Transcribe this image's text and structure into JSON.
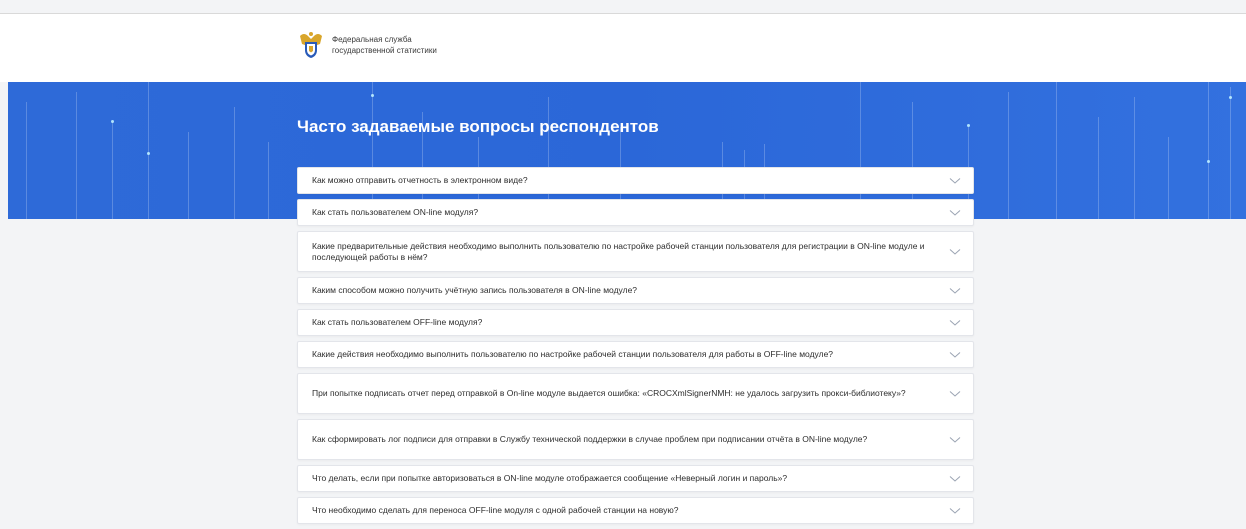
{
  "header": {
    "org_line1": "Федеральная служба",
    "org_line2": "государственной статистики"
  },
  "hero": {
    "title": "Часто задаваемые вопросы респондентов"
  },
  "faq": [
    {
      "question": "Как можно отправить отчетность в электронном виде?"
    },
    {
      "question": "Как стать пользователем ON-line модуля?"
    },
    {
      "question": "Какие предварительные действия необходимо выполнить пользователю по настройке рабочей станции пользователя для регистрации в ON-line модуле и последующей работы в нём?"
    },
    {
      "question": "Каким способом можно получить учётную запись пользователя в ON-line модуле?"
    },
    {
      "question": "Как стать пользователем OFF-line модуля?"
    },
    {
      "question": "Какие действия необходимо выполнить пользователю по настройке рабочей станции пользователя для работы в OFF-line модуле?"
    },
    {
      "question": "При попытке подписать отчет перед отправкой в On-line модуле выдается ошибка: «CROCXmlSignerNMH: не удалось загрузить прокси-библиотеку»?"
    },
    {
      "question": "Как сформировать лог подписи для отправки в Службу технической поддержки в случае проблем при подписании отчёта в ON-line модуле?"
    },
    {
      "question": "Что делать, если при попытке авторизоваться в ON-line модуле отображается сообщение «Неверный логин и пароль»?"
    },
    {
      "question": "Что необходимо сделать для переноса OFF-line модуля с одной рабочей станции на новую?"
    }
  ],
  "colors": {
    "hero_blue": "#2b67d8",
    "page_bg": "#f3f4f6",
    "emblem_gold": "#d9a62b",
    "emblem_blue": "#2a5bb8"
  },
  "icons": {
    "logo": "rosstat-emblem-icon",
    "accordion": "chevron-down-icon"
  }
}
